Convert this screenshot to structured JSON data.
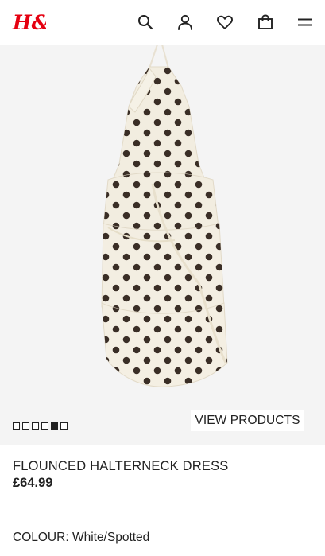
{
  "header": {
    "logo_text": "H&M",
    "logo_color": "#e50010",
    "icons": [
      "search-icon",
      "account-icon",
      "favourites-icon",
      "shopping-bag-icon",
      "menu-icon"
    ]
  },
  "gallery": {
    "slide_count": 6,
    "active_slide": 5,
    "view_products_label": "VIEW PRODUCTS"
  },
  "product": {
    "name": "FLOUNCED HALTERNECK DRESS",
    "price": "£64.99",
    "colour_label": "COLOUR:",
    "colour_value": "White/Spotted"
  }
}
